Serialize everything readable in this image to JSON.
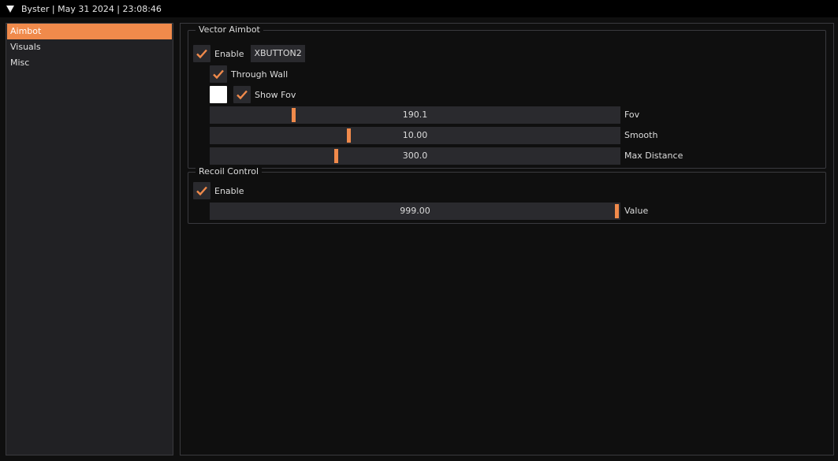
{
  "window": {
    "title": "Byster | May 31 2024 | 23:08:46"
  },
  "sidebar": {
    "items": [
      {
        "label": "Aimbot",
        "active": true
      },
      {
        "label": "Visuals",
        "active": false
      },
      {
        "label": "Misc",
        "active": false
      }
    ]
  },
  "vector_aimbot": {
    "title": "Vector Aimbot",
    "enable": {
      "label": "Enable",
      "checked": true,
      "keybind": "XBUTTON2"
    },
    "through_wall": {
      "label": "Through Wall",
      "checked": true
    },
    "show_fov": {
      "label": "Show Fov",
      "checked": true,
      "color": "#ffffff"
    },
    "sliders": [
      {
        "label": "Fov",
        "value": "190.1",
        "fraction": 0.2
      },
      {
        "label": "Smooth",
        "value": "10.00",
        "fraction": 0.335
      },
      {
        "label": "Max Distance",
        "value": "300.0",
        "fraction": 0.305
      }
    ]
  },
  "recoil_control": {
    "title": "Recoil Control",
    "enable": {
      "label": "Enable",
      "checked": true
    },
    "slider": {
      "label": "Value",
      "value": "999.00",
      "fraction": 1.0
    }
  },
  "colors": {
    "accent": "#f08a4b",
    "frame": "#2a2a2e",
    "background": "#0f0f0f"
  }
}
